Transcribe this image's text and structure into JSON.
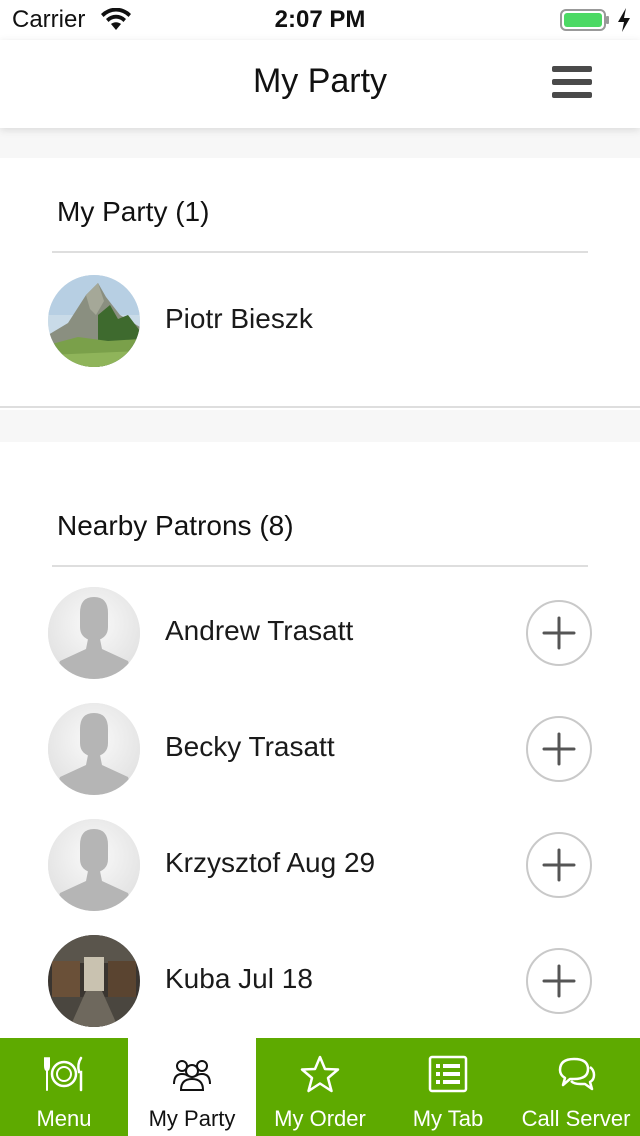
{
  "status_bar": {
    "carrier": "Carrier",
    "time": "2:07 PM",
    "battery_color": "#4cd964"
  },
  "nav": {
    "title": "My Party",
    "menu_icon": "hamburger-icon"
  },
  "my_party": {
    "title": "My Party (1)",
    "members": [
      {
        "name": "Piotr Bieszk",
        "avatar": "mountain-photo"
      }
    ]
  },
  "nearby": {
    "title": "Nearby Patrons (8)",
    "patrons": [
      {
        "name": "Andrew Trasatt",
        "avatar": "default-person",
        "action_icon": "plus-icon"
      },
      {
        "name": "Becky Trasatt",
        "avatar": "default-person",
        "action_icon": "plus-icon"
      },
      {
        "name": "Krzysztof Aug 29",
        "avatar": "default-person",
        "action_icon": "plus-icon"
      },
      {
        "name": "Kuba Jul 18",
        "avatar": "stable-photo",
        "action_icon": "plus-icon"
      }
    ]
  },
  "tab_bar": {
    "accent_color": "#5eaa00",
    "active_index": 1,
    "tabs": [
      {
        "label": "Menu",
        "icon": "plate-cutlery-icon"
      },
      {
        "label": "My Party",
        "icon": "group-icon"
      },
      {
        "label": "My Order",
        "icon": "star-icon"
      },
      {
        "label": "My Tab",
        "icon": "list-icon"
      },
      {
        "label": "Call Server",
        "icon": "chat-bubbles-icon"
      }
    ]
  }
}
